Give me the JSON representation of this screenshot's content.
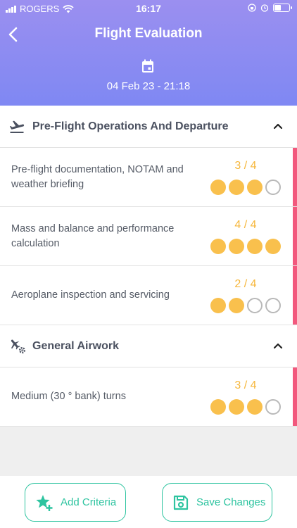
{
  "status_bar": {
    "carrier": "ROGERS",
    "time": "16:17"
  },
  "header": {
    "title": "Flight Evaluation",
    "date": "04 Feb 23 - 21:18"
  },
  "sections": [
    {
      "title": "Pre-Flight Operations And Departure",
      "icon": "airplane-takeoff-icon",
      "items": [
        {
          "label": "Pre-flight documentation, NOTAM and weather briefing",
          "score_text": "3 / 4",
          "score": 3,
          "max": 4
        },
        {
          "label": "Mass and balance and performance calculation",
          "score_text": "4 / 4",
          "score": 4,
          "max": 4
        },
        {
          "label": "Aeroplane inspection and servicing",
          "score_text": "2 / 4",
          "score": 2,
          "max": 4
        }
      ]
    },
    {
      "title": "General Airwork",
      "icon": "airplane-gear-icon",
      "items": [
        {
          "label": "Medium (30 ° bank) turns",
          "score_text": "3 / 4",
          "score": 3,
          "max": 4
        }
      ]
    }
  ],
  "actions": {
    "add_criteria": "Add Criteria",
    "save_changes": "Save Changes"
  },
  "colors": {
    "accent": "#2ec4a0",
    "score": "#f6b73c",
    "rating_fill": "#f9c04d",
    "row_marker": "#f2587d",
    "header_top": "#9b8ff0",
    "header_bottom": "#7f88f3"
  }
}
